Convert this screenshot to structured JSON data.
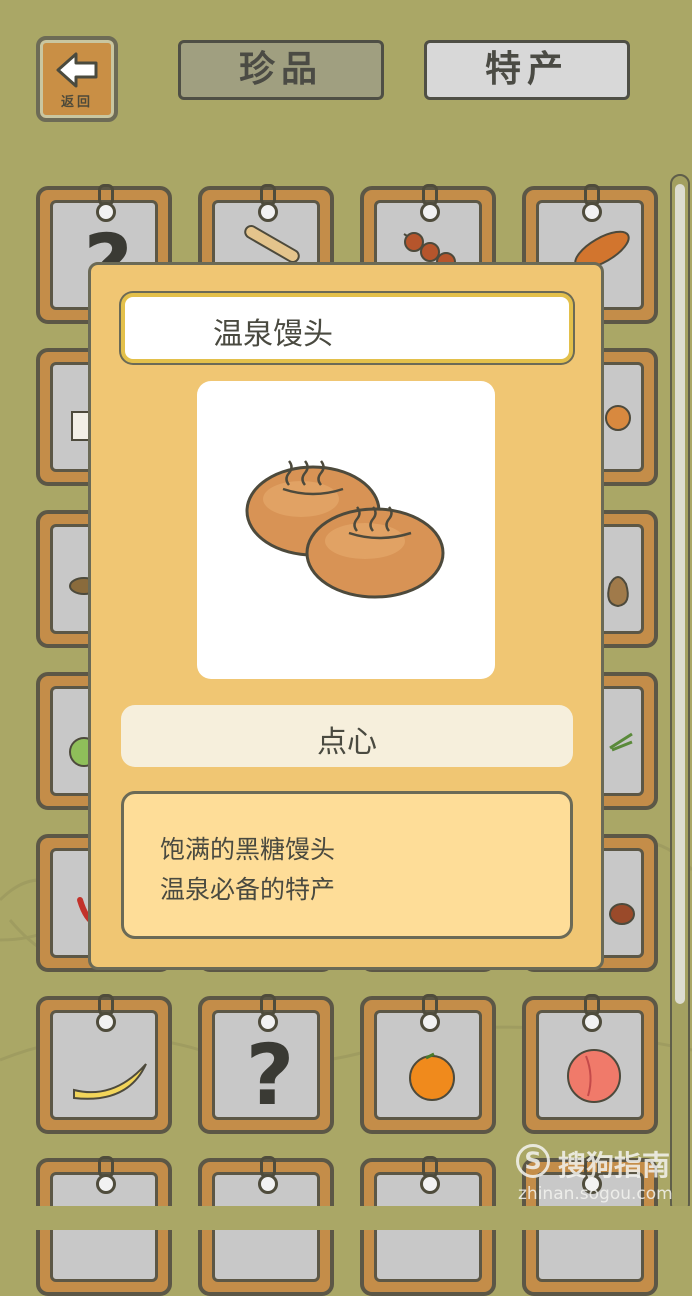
{
  "header": {
    "back_label": "返回",
    "tabs": [
      {
        "label": "珍品",
        "selected": true
      },
      {
        "label": "特产",
        "selected": false
      }
    ]
  },
  "grid": {
    "rows": [
      [
        "question",
        "bread-stick",
        "dango-skewer",
        "sausage-bread"
      ],
      [
        "tofu-block",
        "",
        "",
        "bun"
      ],
      [
        "mushroom",
        "",
        "",
        "sack"
      ],
      [
        "cabbage",
        "",
        "",
        "leek"
      ],
      [
        "chili-pepper",
        "",
        "",
        "chestnut"
      ],
      [
        "banana",
        "question",
        "orange",
        "peach"
      ],
      [
        "",
        "",
        "",
        ""
      ]
    ]
  },
  "detail": {
    "name": "温泉馒头",
    "image_icon": "onsen-manju-icon",
    "category": "点心",
    "description_lines": [
      "饱满的黑糖馒头",
      "温泉必备的特产"
    ]
  },
  "watermark": {
    "logo": "S",
    "text": "搜狗指南",
    "url": "zhinan.sogou.com"
  },
  "colors": {
    "background": "#aaa766",
    "tile_frame": "#c48d49",
    "modal_bg": "#f0c673",
    "desc_bg": "#fedd98"
  }
}
